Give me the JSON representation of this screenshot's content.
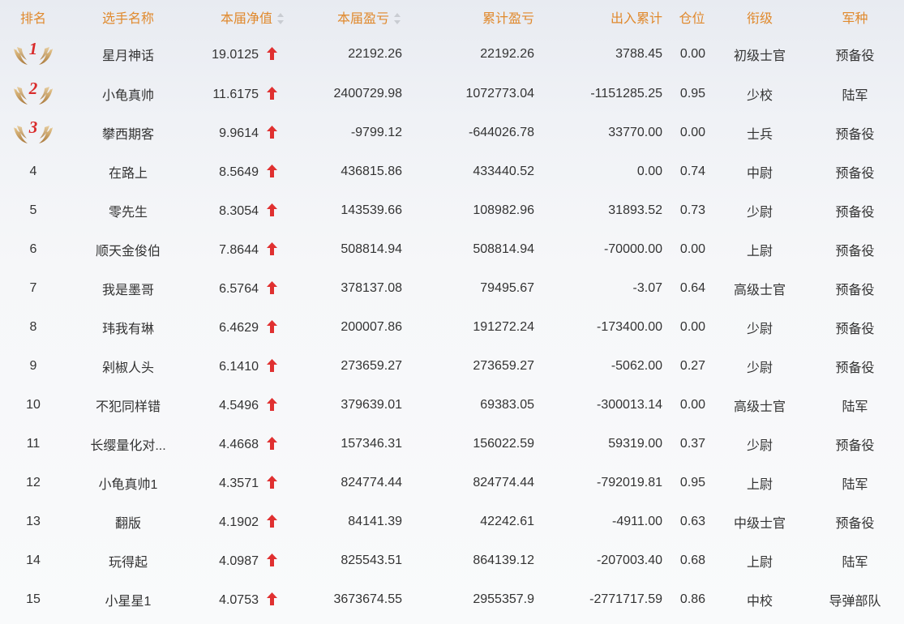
{
  "headers": {
    "rank": "排名",
    "name": "选手名称",
    "nav": "本届净值",
    "current_pnl": "本届盈亏",
    "cumulative_pnl": "累计盈亏",
    "net_flow": "出入累计",
    "position": "仓位",
    "title": "衔级",
    "arm": "军种"
  },
  "sortable_columns": [
    "nav",
    "current_pnl"
  ],
  "colors": {
    "header_text": "#e0892d",
    "up_arrow": "#e03030",
    "medal_number": "#d92b2b",
    "medal_wings": "#c99a55"
  },
  "rows": [
    {
      "rank": "1",
      "medal": true,
      "name": "星月神话",
      "nav": "19.0125",
      "trend": "up",
      "current_pnl": "22192.26",
      "cumulative_pnl": "22192.26",
      "net_flow": "3788.45",
      "position": "0.00",
      "title": "初级士官",
      "arm": "预备役"
    },
    {
      "rank": "2",
      "medal": true,
      "name": "小龟真帅",
      "nav": "11.6175",
      "trend": "up",
      "current_pnl": "2400729.98",
      "cumulative_pnl": "1072773.04",
      "net_flow": "-1151285.25",
      "position": "0.95",
      "title": "少校",
      "arm": "陆军"
    },
    {
      "rank": "3",
      "medal": true,
      "name": "攀西期客",
      "nav": "9.9614",
      "trend": "up",
      "current_pnl": "-9799.12",
      "cumulative_pnl": "-644026.78",
      "net_flow": "33770.00",
      "position": "0.00",
      "title": "士兵",
      "arm": "预备役"
    },
    {
      "rank": "4",
      "medal": false,
      "name": "在路上",
      "nav": "8.5649",
      "trend": "up",
      "current_pnl": "436815.86",
      "cumulative_pnl": "433440.52",
      "net_flow": "0.00",
      "position": "0.74",
      "title": "中尉",
      "arm": "预备役"
    },
    {
      "rank": "5",
      "medal": false,
      "name": "零先生",
      "nav": "8.3054",
      "trend": "up",
      "current_pnl": "143539.66",
      "cumulative_pnl": "108982.96",
      "net_flow": "31893.52",
      "position": "0.73",
      "title": "少尉",
      "arm": "预备役"
    },
    {
      "rank": "6",
      "medal": false,
      "name": "顺天金俊伯",
      "nav": "7.8644",
      "trend": "up",
      "current_pnl": "508814.94",
      "cumulative_pnl": "508814.94",
      "net_flow": "-70000.00",
      "position": "0.00",
      "title": "上尉",
      "arm": "预备役"
    },
    {
      "rank": "7",
      "medal": false,
      "name": "我是墨哥",
      "nav": "6.5764",
      "trend": "up",
      "current_pnl": "378137.08",
      "cumulative_pnl": "79495.67",
      "net_flow": "-3.07",
      "position": "0.64",
      "title": "高级士官",
      "arm": "预备役"
    },
    {
      "rank": "8",
      "medal": false,
      "name": "玮我有琳",
      "nav": "6.4629",
      "trend": "up",
      "current_pnl": "200007.86",
      "cumulative_pnl": "191272.24",
      "net_flow": "-173400.00",
      "position": "0.00",
      "title": "少尉",
      "arm": "预备役"
    },
    {
      "rank": "9",
      "medal": false,
      "name": "剁椒人头",
      "nav": "6.1410",
      "trend": "up",
      "current_pnl": "273659.27",
      "cumulative_pnl": "273659.27",
      "net_flow": "-5062.00",
      "position": "0.27",
      "title": "少尉",
      "arm": "预备役"
    },
    {
      "rank": "10",
      "medal": false,
      "name": "不犯同样错",
      "nav": "4.5496",
      "trend": "up",
      "current_pnl": "379639.01",
      "cumulative_pnl": "69383.05",
      "net_flow": "-300013.14",
      "position": "0.00",
      "title": "高级士官",
      "arm": "陆军"
    },
    {
      "rank": "11",
      "medal": false,
      "name": "长缨量化对...",
      "nav": "4.4668",
      "trend": "up",
      "current_pnl": "157346.31",
      "cumulative_pnl": "156022.59",
      "net_flow": "59319.00",
      "position": "0.37",
      "title": "少尉",
      "arm": "预备役"
    },
    {
      "rank": "12",
      "medal": false,
      "name": "小龟真帅1",
      "nav": "4.3571",
      "trend": "up",
      "current_pnl": "824774.44",
      "cumulative_pnl": "824774.44",
      "net_flow": "-792019.81",
      "position": "0.95",
      "title": "上尉",
      "arm": "陆军"
    },
    {
      "rank": "13",
      "medal": false,
      "name": "翻版",
      "nav": "4.1902",
      "trend": "up",
      "current_pnl": "84141.39",
      "cumulative_pnl": "42242.61",
      "net_flow": "-4911.00",
      "position": "0.63",
      "title": "中级士官",
      "arm": "预备役"
    },
    {
      "rank": "14",
      "medal": false,
      "name": "玩得起",
      "nav": "4.0987",
      "trend": "up",
      "current_pnl": "825543.51",
      "cumulative_pnl": "864139.12",
      "net_flow": "-207003.40",
      "position": "0.68",
      "title": "上尉",
      "arm": "陆军"
    },
    {
      "rank": "15",
      "medal": false,
      "name": "小星星1",
      "nav": "4.0753",
      "trend": "up",
      "current_pnl": "3673674.55",
      "cumulative_pnl": "2955357.9",
      "net_flow": "-2771717.59",
      "position": "0.86",
      "title": "中校",
      "arm": "导弹部队"
    }
  ]
}
